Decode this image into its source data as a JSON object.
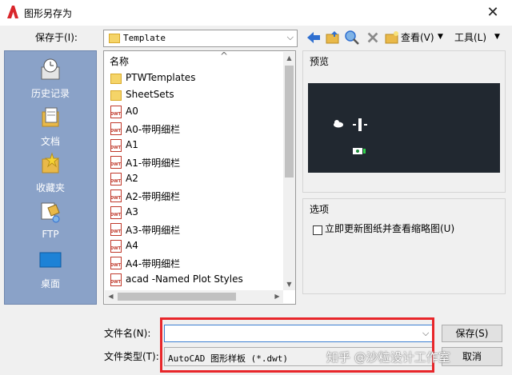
{
  "window": {
    "title": "图形另存为",
    "close_glyph": "✕"
  },
  "save_in": {
    "label": "保存于(I):",
    "value": "Template"
  },
  "toolbar": {
    "view_label": "查看(V)",
    "tools_label": "工具(L)"
  },
  "places": [
    {
      "label": "历史记录",
      "icon": "history-icon"
    },
    {
      "label": "文档",
      "icon": "documents-icon"
    },
    {
      "label": "收藏夹",
      "icon": "favorites-icon"
    },
    {
      "label": "FTP",
      "icon": "ftp-icon"
    },
    {
      "label": "桌面",
      "icon": "desktop-icon"
    }
  ],
  "file_list": {
    "column_name": "名称",
    "items": [
      {
        "name": "PTWTemplates",
        "type": "folder"
      },
      {
        "name": "SheetSets",
        "type": "folder"
      },
      {
        "name": "A0",
        "type": "dwt"
      },
      {
        "name": "A0-带明细栏",
        "type": "dwt"
      },
      {
        "name": "A1",
        "type": "dwt"
      },
      {
        "name": "A1-带明细栏",
        "type": "dwt"
      },
      {
        "name": "A2",
        "type": "dwt"
      },
      {
        "name": "A2-带明细栏",
        "type": "dwt"
      },
      {
        "name": "A3",
        "type": "dwt"
      },
      {
        "name": "A3-带明细栏",
        "type": "dwt"
      },
      {
        "name": "A4",
        "type": "dwt"
      },
      {
        "name": "A4-带明细栏",
        "type": "dwt"
      },
      {
        "name": "acad -Named Plot Styles",
        "type": "dwt"
      }
    ]
  },
  "preview": {
    "title": "预览",
    "background": "#212830"
  },
  "options": {
    "title": "选项",
    "checkbox_label": "立即更新图纸并查看缩略图(U)",
    "checked": false
  },
  "file_name": {
    "label": "文件名(N):",
    "value": ""
  },
  "file_type": {
    "label": "文件类型(T):",
    "value": "AutoCAD 图形样板 (*.dwt)"
  },
  "buttons": {
    "save": "保存(S)",
    "cancel": "取消"
  },
  "watermark": "知乎 @沙粒设计工作室",
  "colors": {
    "places_bg": "#8aa2c8",
    "highlight": "#e8262a",
    "focus_border": "#3c7fd1"
  }
}
